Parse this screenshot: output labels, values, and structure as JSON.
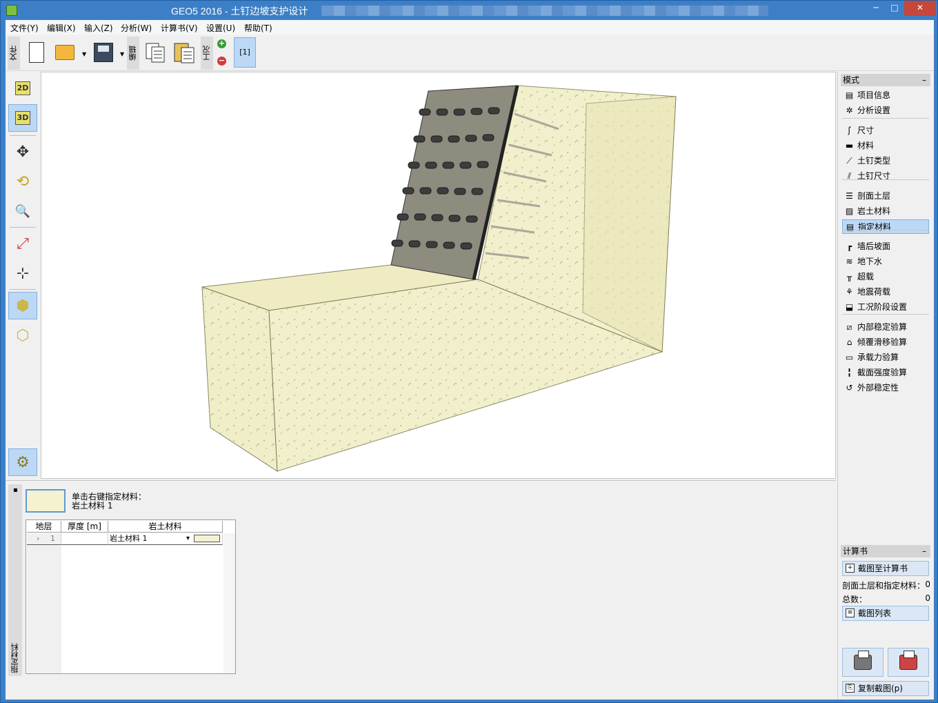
{
  "window": {
    "title": "GEO5 2016 - 土钉边坡支护设计",
    "minimize": "─",
    "maximize": "□",
    "close": "✕"
  },
  "menu": [
    "文件(Y)",
    "编辑(X)",
    "输入(Z)",
    "分析(W)",
    "计算书(V)",
    "设置(U)",
    "帮助(T)"
  ],
  "toolbar": {
    "group_file": "文件",
    "group_edit": "编辑",
    "group_stage": "工况",
    "add": "+",
    "remove": "−",
    "stage_button": "[1]"
  },
  "left_tools": {
    "view_2d": "2D",
    "view_3d": "3D",
    "move": "✥",
    "rotate": "⟲",
    "zoom": "🔍",
    "fit": "⤢",
    "axes": "⊹",
    "solid": "⬢",
    "wire": "⬡",
    "settings": "⚙"
  },
  "right_panel": {
    "mode_header": "模式",
    "collapse": "–",
    "items": [
      {
        "label": "项目信息",
        "icon": "document-icon",
        "glyph": "▤"
      },
      {
        "label": "分析设置",
        "icon": "gear-icon",
        "glyph": "✲"
      },
      {
        "label": "尺寸",
        "icon": "dimension-icon",
        "glyph": "ʃ"
      },
      {
        "label": "材料",
        "icon": "material-icon",
        "glyph": "▬"
      },
      {
        "label": "土钉类型",
        "icon": "nail-type-icon",
        "glyph": "⟋"
      },
      {
        "label": "土钉尺寸",
        "icon": "nail-size-icon",
        "glyph": "⫽"
      },
      {
        "label": "剖面土层",
        "icon": "layers-icon",
        "glyph": "☰"
      },
      {
        "label": "岩土材料",
        "icon": "soil-icon",
        "glyph": "▨"
      },
      {
        "label": "指定材料",
        "icon": "assign-icon",
        "glyph": "▤"
      },
      {
        "label": "墙后坡面",
        "icon": "terrain-icon",
        "glyph": "┏"
      },
      {
        "label": "地下水",
        "icon": "water-icon",
        "glyph": "≋"
      },
      {
        "label": "超载",
        "icon": "surcharge-icon",
        "glyph": "╥"
      },
      {
        "label": "地震荷载",
        "icon": "earthquake-icon",
        "glyph": "⚘"
      },
      {
        "label": "工况阶段设置",
        "icon": "stage-icon",
        "glyph": "⬓"
      },
      {
        "label": "内部稳定验算",
        "icon": "internal-stability-icon",
        "glyph": "⧄"
      },
      {
        "label": "倾覆滑移验算",
        "icon": "overturning-icon",
        "glyph": "⌂"
      },
      {
        "label": "承载力验算",
        "icon": "bearing-icon",
        "glyph": "▭"
      },
      {
        "label": "截面强度验算",
        "icon": "section-icon",
        "glyph": "╏"
      },
      {
        "label": "外部稳定性",
        "icon": "external-stability-icon",
        "glyph": "↺"
      }
    ],
    "selected_index": 8,
    "report_header": "计算书",
    "add_picture": "截图至计算书",
    "count_label": "剖面土层和指定材料：",
    "count_value": "0",
    "total_label": "总数：",
    "total_value": "0",
    "picture_list": "截图列表",
    "copy_picture": "复制截图(p)"
  },
  "bottom_panel": {
    "tab_label": "指定材料",
    "pin": "▪",
    "hint_line1": "单击右键指定材料：",
    "hint_line2": "岩土材料 1",
    "columns": [
      "地层",
      "厚度 [m]",
      "岩土材料"
    ],
    "rows": [
      {
        "layer": "1",
        "thickness": "",
        "material": "岩土材料 1"
      }
    ],
    "row_marker": "›",
    "dropdown_arrow": "▾"
  },
  "colors": {
    "title_bar": "#3d7fc7",
    "selected_bg": "#bcd8f5",
    "soil_fill": "#efedc4",
    "wall_fill": "#8e8c7e"
  }
}
